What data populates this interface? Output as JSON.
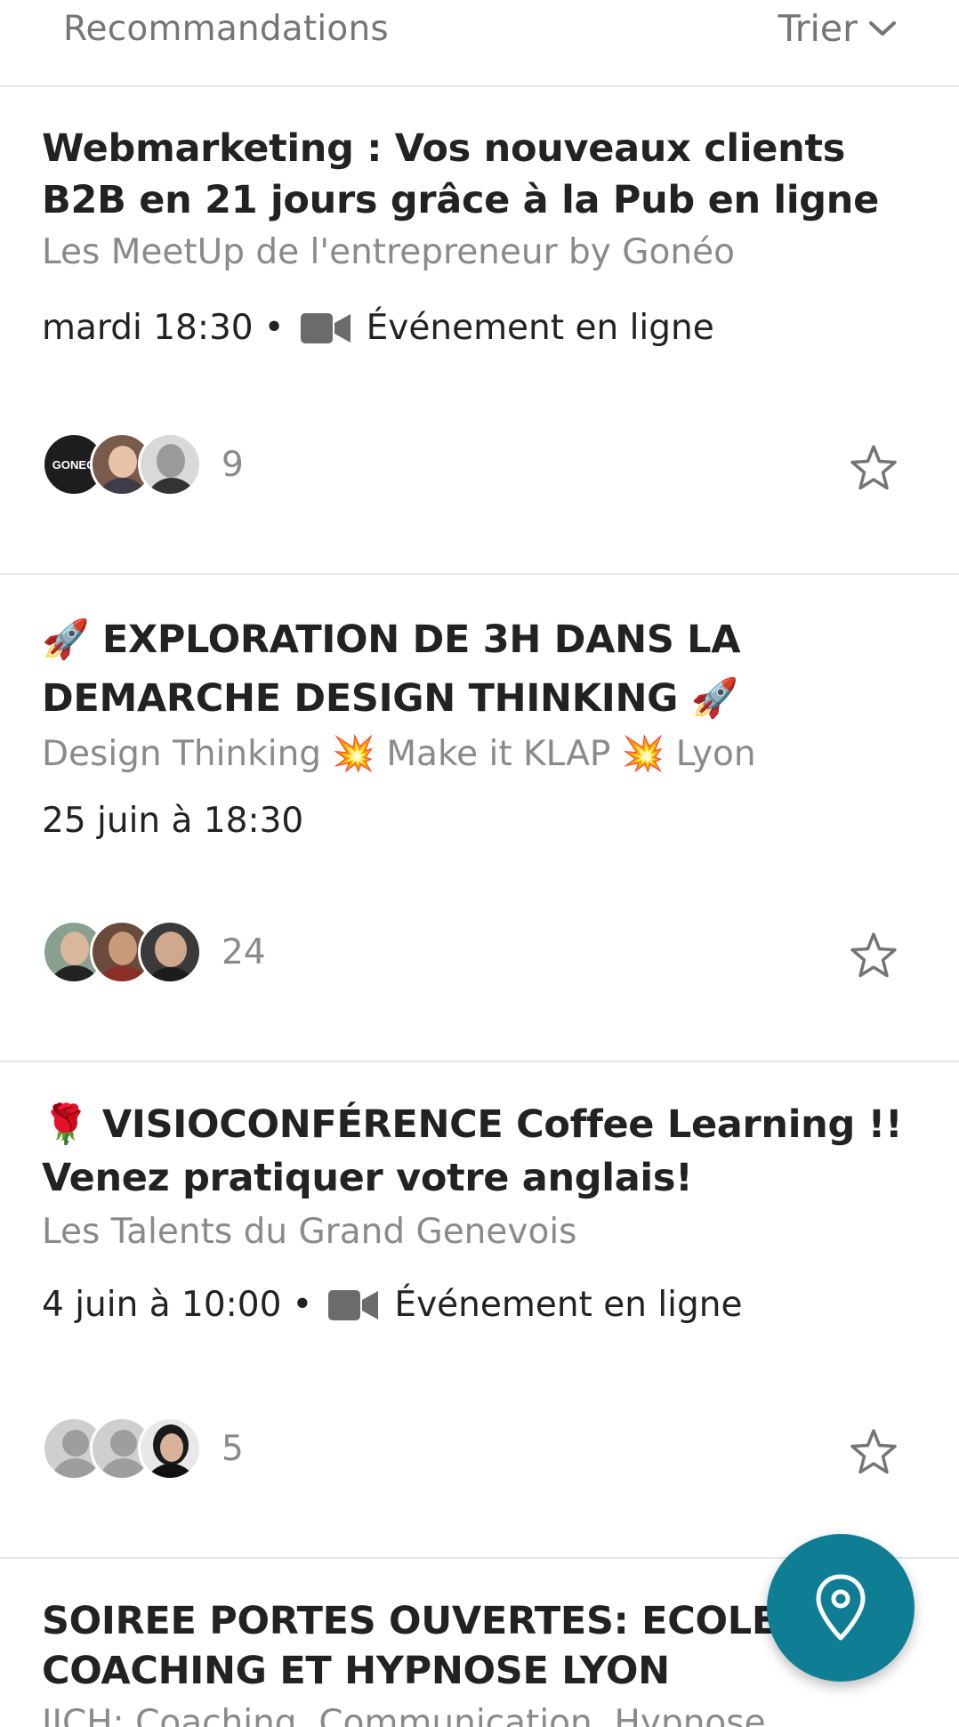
{
  "header": {
    "title": "Recommandations",
    "sort_label": "Trier",
    "sort_icon": "chevron-down-icon"
  },
  "events": [
    {
      "title": "Webmarketing : Vos nouveaux clients B2B en 21 jours grâce à la Pub en ligne",
      "group": "Les MeetUp de l'entrepreneur by Gonéo",
      "datetime": "mardi 18:30",
      "separator": "•",
      "online_label": "Événement en ligne",
      "attendees": "9",
      "avatar_logo_text": "GONEO"
    },
    {
      "title": "🚀 EXPLORATION DE 3H DANS LA DEMARCHE DESIGN THINKING 🚀",
      "group": "Design Thinking 💥 Make it KLAP 💥 Lyon",
      "datetime": "25 juin à 18:30",
      "attendees": "24"
    },
    {
      "title": "🌹 VISIOCONFÉRENCE Coffee Learning !! Venez pratiquer votre anglais!",
      "group": "Les Talents du Grand Genevois",
      "datetime": "4 juin à 10:00",
      "separator": "•",
      "online_label": "Événement en ligne",
      "attendees": "5"
    },
    {
      "title": "SOIREE PORTES OUVERTES: ECOLE COACHING ET HYPNOSE LYON",
      "group": "IICH: Coaching, Communication, Hypnose"
    }
  ],
  "fab": {
    "icon": "map-pin-icon"
  },
  "colors": {
    "accent": "#0f7e95",
    "muted": "#8a8a8a",
    "text": "#222222"
  }
}
